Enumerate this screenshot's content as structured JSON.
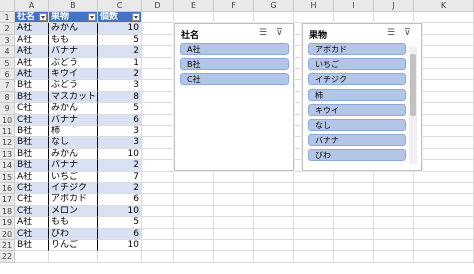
{
  "columns": [
    "A",
    "B",
    "C",
    "D",
    "E",
    "F",
    "G",
    "H",
    "I",
    "J",
    "K"
  ],
  "row_numbers": [
    "1",
    "2",
    "3",
    "4",
    "5",
    "6",
    "7",
    "8",
    "9",
    "10",
    "11",
    "12",
    "13",
    "14",
    "15",
    "16",
    "17",
    "18",
    "19",
    "20",
    "21",
    "22"
  ],
  "table": {
    "headers": [
      "社名",
      "果物",
      "個数"
    ],
    "rows": [
      [
        "A社",
        "みかん",
        "10"
      ],
      [
        "A社",
        "もも",
        "5"
      ],
      [
        "A社",
        "バナナ",
        "2"
      ],
      [
        "A社",
        "ぶどう",
        "1"
      ],
      [
        "A社",
        "キウイ",
        "2"
      ],
      [
        "B社",
        "ぶどう",
        "3"
      ],
      [
        "B社",
        "マスカット",
        "8"
      ],
      [
        "C社",
        "みかん",
        "5"
      ],
      [
        "C社",
        "バナナ",
        "6"
      ],
      [
        "B社",
        "柿",
        "3"
      ],
      [
        "B社",
        "なし",
        "3"
      ],
      [
        "B社",
        "みかん",
        "10"
      ],
      [
        "B社",
        "バナナ",
        "2"
      ],
      [
        "A社",
        "いちご",
        "7"
      ],
      [
        "C社",
        "イチジク",
        "2"
      ],
      [
        "C社",
        "アボカド",
        "6"
      ],
      [
        "C社",
        "メロン",
        "10"
      ],
      [
        "A社",
        "もも",
        "5"
      ],
      [
        "C社",
        "びわ",
        "6"
      ],
      [
        "B社",
        "りんご",
        "10"
      ]
    ]
  },
  "slicer1": {
    "title": "社名",
    "items": [
      "A社",
      "B社",
      "C社"
    ]
  },
  "slicer2": {
    "title": "果物",
    "items": [
      "アボカド",
      "いちご",
      "イチジク",
      "柿",
      "キウイ",
      "なし",
      "バナナ",
      "びわ"
    ]
  },
  "icons": {
    "multiselect": "multi-select-icon",
    "clear_filter": "clear-filter-icon"
  }
}
